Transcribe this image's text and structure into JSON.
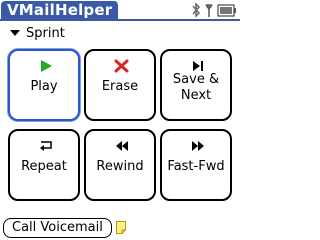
{
  "app": {
    "title": "VMailHelper"
  },
  "carrier": {
    "label": "Sprint"
  },
  "buttons": {
    "play": "Play",
    "erase": "Erase",
    "save_next_1": "Save &",
    "save_next_2": "Next",
    "repeat": "Repeat",
    "rewind": "Rewind",
    "fastfwd": "Fast-Fwd"
  },
  "footer": {
    "call_voicemail": "Call Voicemail"
  },
  "icons": {
    "play": "play-icon",
    "erase": "x-icon",
    "save_next": "skip-next-icon",
    "repeat": "return-arrow-icon",
    "rewind": "rewind-icon",
    "fastfwd": "fast-forward-icon",
    "bluetooth": "bluetooth-icon",
    "signal": "signal-icon",
    "battery": "battery-icon",
    "note": "note-icon"
  },
  "colors": {
    "title_tab": "#3a5aa8",
    "play_green": "#22aa22",
    "erase_red": "#dd2222",
    "focus_border": "#2d56c8"
  }
}
